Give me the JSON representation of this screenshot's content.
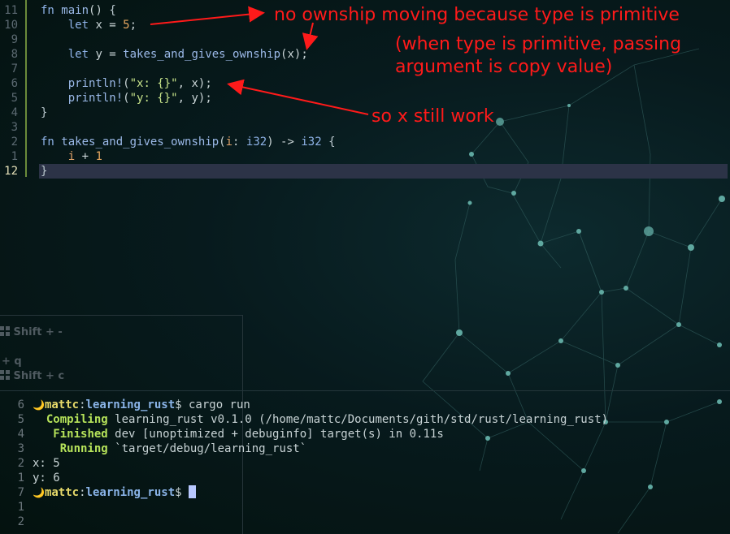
{
  "editor": {
    "lines": [
      {
        "num": "11",
        "parts": [
          [
            "kw",
            "fn "
          ],
          [
            "fn",
            "main"
          ],
          [
            "pl",
            "() "
          ],
          [
            "brace",
            "{"
          ]
        ]
      },
      {
        "num": "10",
        "parts": [
          [
            "pl",
            "    "
          ],
          [
            "kw",
            "let "
          ],
          [
            "pl",
            "x = "
          ],
          [
            "num",
            "5"
          ],
          [
            "pl",
            ";"
          ]
        ]
      },
      {
        "num": "9",
        "parts": []
      },
      {
        "num": "8",
        "parts": [
          [
            "pl",
            "    "
          ],
          [
            "kw",
            "let "
          ],
          [
            "pl",
            "y = "
          ],
          [
            "fn",
            "takes_and_gives_ownship"
          ],
          [
            "pl",
            "(x);"
          ]
        ]
      },
      {
        "num": "7",
        "parts": []
      },
      {
        "num": "6",
        "parts": [
          [
            "pl",
            "    "
          ],
          [
            "mac",
            "println!"
          ],
          [
            "pl",
            "("
          ],
          [
            "str",
            "\"x: {}\""
          ],
          [
            "pl",
            ", x);"
          ]
        ]
      },
      {
        "num": "5",
        "parts": [
          [
            "pl",
            "    "
          ],
          [
            "mac",
            "println!"
          ],
          [
            "pl",
            "("
          ],
          [
            "str",
            "\"y: {}\""
          ],
          [
            "pl",
            ", y);"
          ]
        ]
      },
      {
        "num": "4",
        "parts": [
          [
            "brace",
            "}"
          ]
        ]
      },
      {
        "num": "3",
        "parts": []
      },
      {
        "num": "2",
        "parts": [
          [
            "kw",
            "fn "
          ],
          [
            "fn",
            "takes_and_gives_ownship"
          ],
          [
            "pl",
            "("
          ],
          [
            "var",
            "i"
          ],
          [
            "pl",
            ": "
          ],
          [
            "ty",
            "i32"
          ],
          [
            "pl",
            ") -> "
          ],
          [
            "ty",
            "i32"
          ],
          [
            "pl",
            " "
          ],
          [
            "brace",
            "{"
          ]
        ]
      },
      {
        "num": "1",
        "parts": [
          [
            "pl",
            "    "
          ],
          [
            "var",
            "i"
          ],
          [
            "pl",
            " + "
          ],
          [
            "num",
            "1"
          ]
        ]
      },
      {
        "num": "12",
        "parts": [
          [
            "brace",
            "}"
          ]
        ],
        "current": true
      }
    ]
  },
  "annotations": {
    "ownership": "no ownship moving because type is primitive",
    "copy_line1": "(when type is primitive, passing",
    "copy_line2": "argument is copy value)",
    "still_work": "so x still work"
  },
  "shortcuts": {
    "one": "Shift + -",
    "two": "+ q",
    "three": "Shift + c"
  },
  "terminal": {
    "lines": [
      {
        "num": "6",
        "type": "prompt",
        "user": "mattc",
        "dir": "learning_rust",
        "cmd": "$ cargo run"
      },
      {
        "num": "5",
        "type": "status",
        "label": "Compiling",
        "text": " learning_rust v0.1.0 (/home/mattc/Documents/gith/std/rust/learning_rust)",
        "indent": "  "
      },
      {
        "num": "4",
        "type": "status",
        "label": "Finished",
        "text": " dev [unoptimized + debuginfo] target(s) in 0.11s",
        "indent": "   "
      },
      {
        "num": "3",
        "type": "status",
        "label": "Running",
        "text": " `target/debug/learning_rust`",
        "indent": "    "
      },
      {
        "num": "2",
        "type": "plain",
        "text": "x: 5"
      },
      {
        "num": "1",
        "type": "plain",
        "text": "y: 6"
      },
      {
        "num": "7",
        "type": "prompt",
        "user": "mattc",
        "dir": "learning_rust",
        "cmd": "$ ",
        "cursor": true
      },
      {
        "num": "1",
        "type": "plain",
        "text": ""
      },
      {
        "num": "2",
        "type": "plain",
        "text": ""
      }
    ],
    "moon_icon": "🌙"
  },
  "colors": {
    "annotation": "#ff1a1a",
    "current_line": "#2c3347",
    "cursor": "#b8c8ff"
  }
}
